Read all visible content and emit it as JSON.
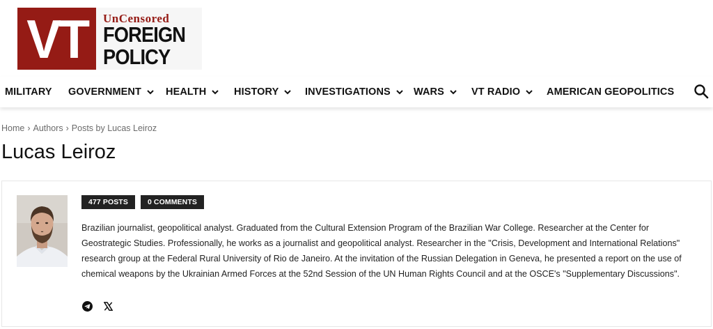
{
  "logo": {
    "vt": "VT",
    "tagline_small": "UnCensored",
    "line1": "FOREIGN",
    "line2": "POLICY"
  },
  "nav": {
    "items": [
      {
        "label": "MILITARY",
        "has_dropdown": false
      },
      {
        "label": "GOVERNMENT",
        "has_dropdown": true
      },
      {
        "label": "HEALTH",
        "has_dropdown": true
      },
      {
        "label": "HISTORY",
        "has_dropdown": true
      },
      {
        "label": "INVESTIGATIONS",
        "has_dropdown": true
      },
      {
        "label": "WARS",
        "has_dropdown": true
      },
      {
        "label": "VT RADIO",
        "has_dropdown": true
      },
      {
        "label": "AMERICAN GEOPOLITICS",
        "has_dropdown": false
      }
    ],
    "search_icon": "search-icon"
  },
  "breadcrumb": {
    "home": "Home",
    "authors": "Authors",
    "current": "Posts by Lucas Leiroz",
    "separator": "›"
  },
  "page_title": "Lucas Leiroz",
  "author": {
    "posts_badge": "477 POSTS",
    "comments_badge": "0 COMMENTS",
    "bio": "Brazilian journalist, geopolitical analyst. Graduated from the Cultural Extension Program of the Brazilian War College. Researcher at the Center for Geostrategic Studies. Professionally, he works as a journalist and geopolitical analyst. Researcher in the \"Crisis, Development and International Relations\" research group at the Federal Rural University of Rio de Janeiro. At the invitation of the Russian Delegation in Geneva, he presented a report on the use of chemical weapons by the Ukrainian Armed Forces at the 52nd Session of the UN Human Rights Council and at the OSCE's \"Supplementary Discussions\".",
    "socials": [
      "telegram-icon",
      "x-icon"
    ]
  },
  "colors": {
    "brand_red": "#951b15",
    "badge_bg": "#222222",
    "text": "#111111",
    "muted": "#6b6b6b"
  }
}
